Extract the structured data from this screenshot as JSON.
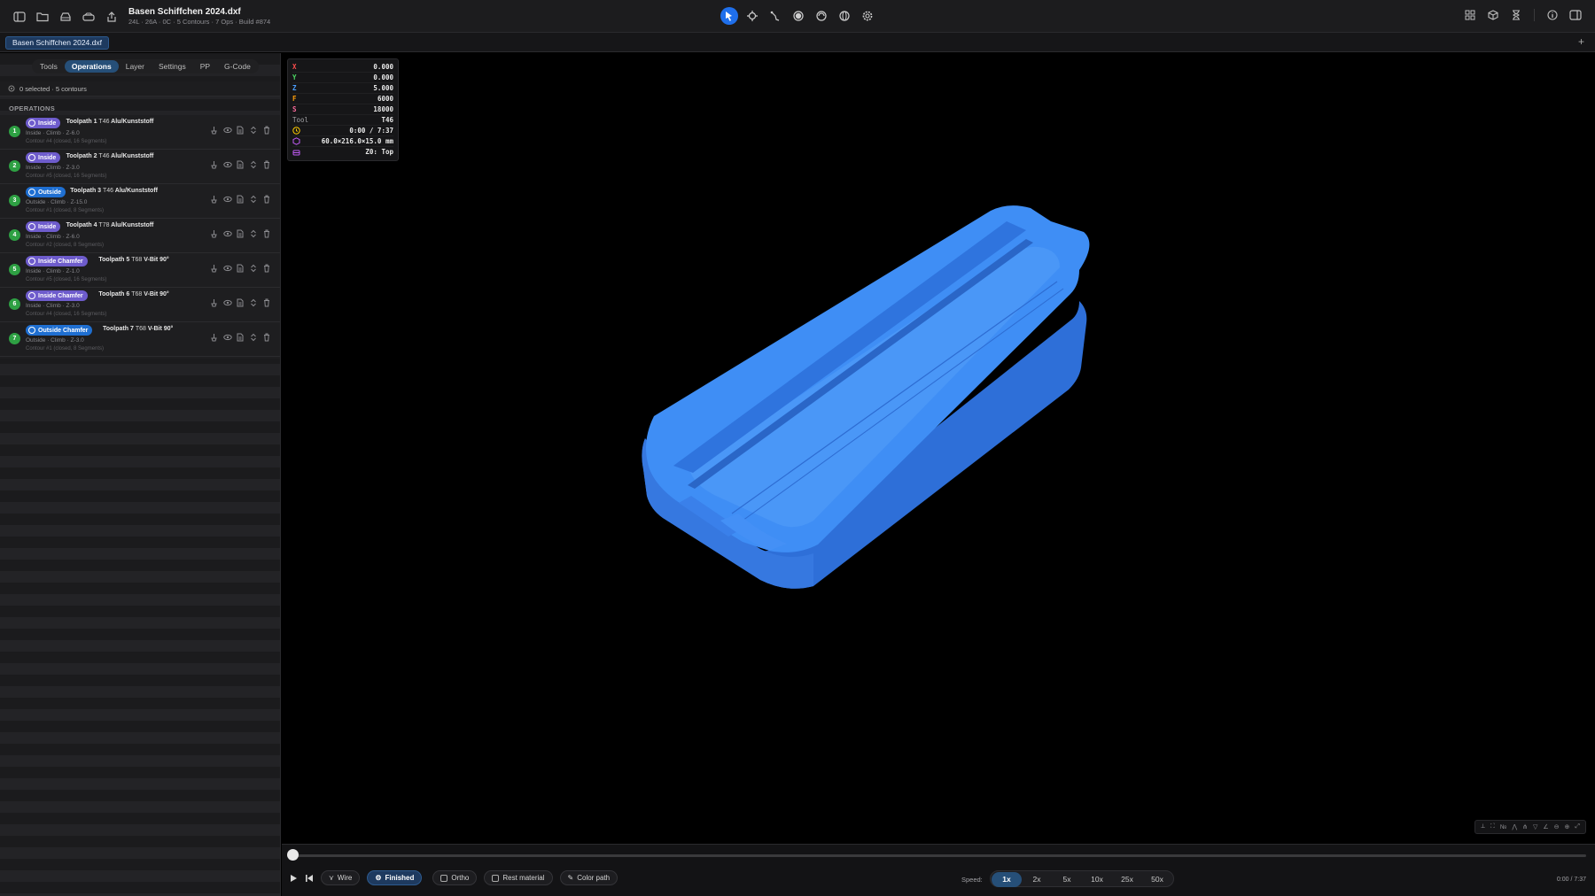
{
  "app": {
    "title": "Basen Schiffchen 2024.dxf",
    "subtitle": "24L · 26A · 0C · 5 Contours · 7 Ops · Build #874",
    "file_tab": "Basen Schiffchen 2024.dxf",
    "add_tab": "+"
  },
  "sidebar": {
    "tabs": [
      {
        "label": "Tools",
        "active": false
      },
      {
        "label": "Operations",
        "active": true
      },
      {
        "label": "Layer",
        "active": false
      },
      {
        "label": "Settings",
        "active": false
      },
      {
        "label": "PP",
        "active": false
      },
      {
        "label": "G-Code",
        "active": false
      }
    ],
    "selection_info": "0 selected · 5 contours",
    "operations_heading": "OPERATIONS",
    "operations": [
      {
        "num": "1",
        "badge": "Inside",
        "badge_type": "inside",
        "name": "Toolpath 1",
        "tool": "T46",
        "material": "Alu/Kunststoff",
        "meta": "Inside  ·  Climb  ·  Z-6.0",
        "contour": "Contour #4 (closed, 16 Segments)"
      },
      {
        "num": "2",
        "badge": "Inside",
        "badge_type": "inside",
        "name": "Toolpath 2",
        "tool": "T46",
        "material": "Alu/Kunststoff",
        "meta": "Inside  ·  Climb  ·  Z-3.0",
        "contour": "Contour #5 (closed, 16 Segments)"
      },
      {
        "num": "3",
        "badge": "Outside",
        "badge_type": "outside",
        "name": "Toolpath 3",
        "tool": "T46",
        "material": "Alu/Kunststoff",
        "meta": "Outside  ·  Climb  ·  Z-15.0",
        "contour": "Contour #1 (closed, 8 Segments)"
      },
      {
        "num": "4",
        "badge": "Inside",
        "badge_type": "inside",
        "name": "Toolpath 4",
        "tool": "T78",
        "material": "Alu/Kunststoff",
        "meta": "Inside  ·  Climb  ·  Z-6.0",
        "contour": "Contour #2 (closed, 8 Segments)"
      },
      {
        "num": "5",
        "badge": "Inside Chamfer",
        "badge_type": "inside",
        "name": "Toolpath 5",
        "tool": "T68",
        "material": "V-Bit 90°",
        "meta": "Inside  ·  Climb  ·  Z-1.0",
        "contour": "Contour #5 (closed, 16 Segments)"
      },
      {
        "num": "6",
        "badge": "Inside Chamfer",
        "badge_type": "inside",
        "name": "Toolpath 6",
        "tool": "T68",
        "material": "V-Bit 90°",
        "meta": "Inside  ·  Climb  ·  Z-3.0",
        "contour": "Contour #4 (closed, 16 Segments)"
      },
      {
        "num": "7",
        "badge": "Outside Chamfer",
        "badge_type": "outside",
        "name": "Toolpath 7",
        "tool": "T68",
        "material": "V-Bit 90°",
        "meta": "Outside  ·  Climb  ·  Z-3.0",
        "contour": "Contour #1 (closed, 8 Segments)"
      }
    ]
  },
  "hud": {
    "x_label": "X",
    "x": "0.000",
    "y_label": "Y",
    "y": "0.000",
    "z_label": "Z",
    "z": "5.000",
    "f_label": "F",
    "f": "6000",
    "s_label": "S",
    "s": "18000",
    "tool_label": "Tool",
    "tool": "T46",
    "time": "0:00 / 7:37",
    "dims": "60.0×216.0×15.0 mm",
    "zero": "Z0: Top",
    "colors": {
      "x": "#ff4d4d",
      "y": "#4cd964",
      "z": "#4a9eff",
      "f": "#ff9f0a",
      "s": "#ff6b9d",
      "tool": "#a0a0a4"
    }
  },
  "playback": {
    "wire": "Wire",
    "finished": "Finished",
    "ortho": "Ortho",
    "rest_material": "Rest material",
    "color_path": "Color path",
    "speed_label": "Speed:",
    "speeds": [
      "1x",
      "2x",
      "5x",
      "10x",
      "25x",
      "50x"
    ],
    "active_speed": "1x",
    "time": "0:00 / 7:37",
    "progress": 0
  },
  "colors": {
    "accent": "#1f6feb",
    "model": "#3f8ef5",
    "success": "#2ea043",
    "inside": "#6e5ccc",
    "outside": "#1f6fd1"
  }
}
